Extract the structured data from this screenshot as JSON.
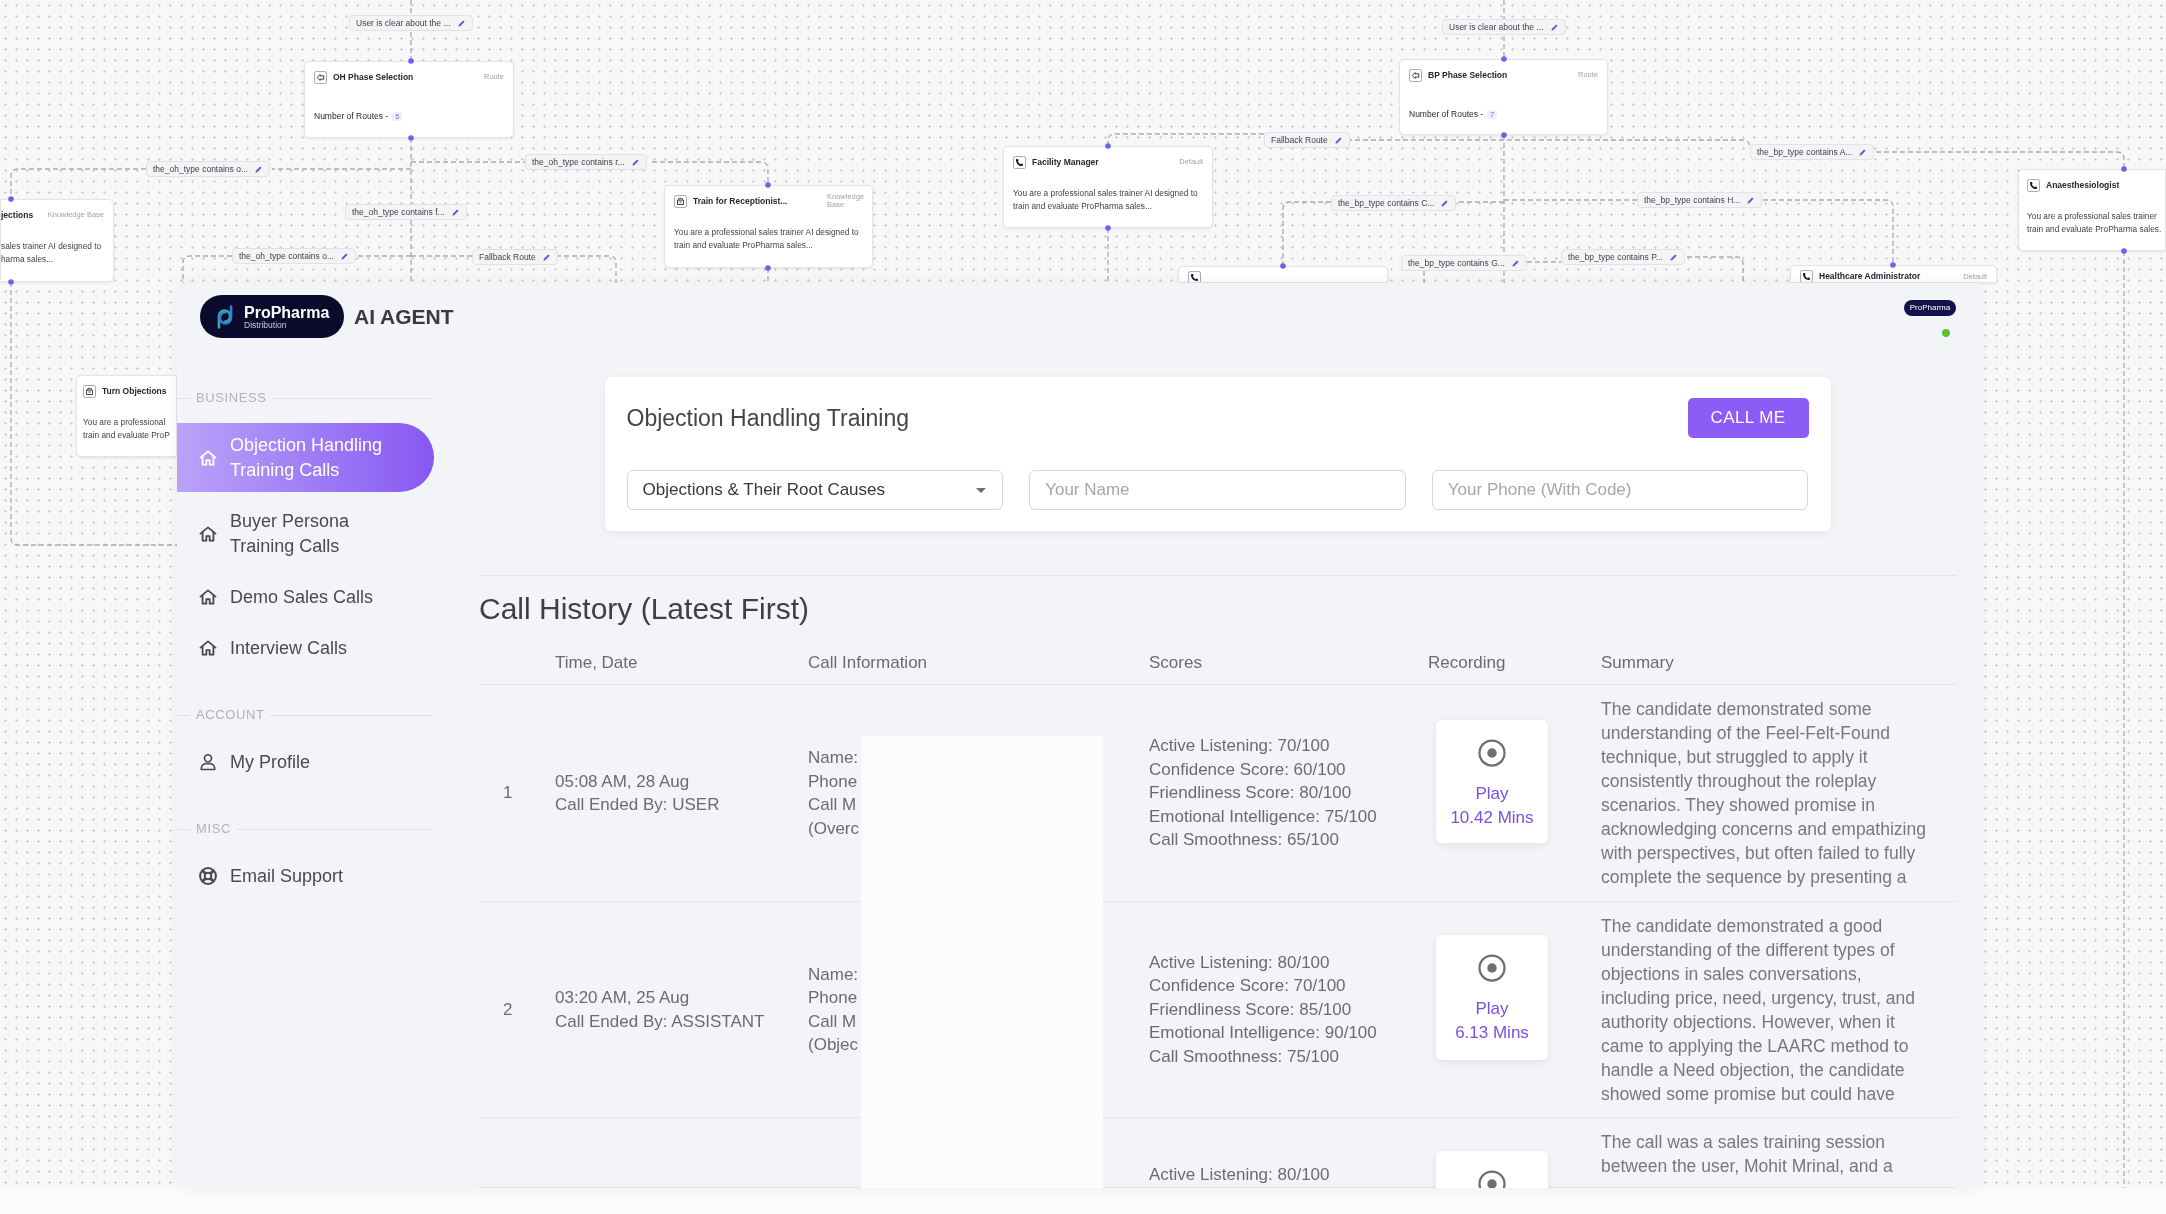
{
  "diagram": {
    "edge_labels": [
      {
        "text": "User is clear about the ..."
      },
      {
        "text": "User is clear about the ..."
      },
      {
        "text": "Fallback Route"
      },
      {
        "text": "the_bp_type contains A..."
      },
      {
        "text": "the_oh_type contains o..."
      },
      {
        "text": "the_oh_type contains r..."
      },
      {
        "text": "the_bp_type contains C..."
      },
      {
        "text": "the_bp_type contains H..."
      },
      {
        "text": "the_oh_type contains f..."
      },
      {
        "text": "the_oh_type contains o..."
      },
      {
        "text": "Fallback Route"
      },
      {
        "text": "the_bp_type contains G..."
      },
      {
        "text": "the_bp_type contains P..."
      }
    ],
    "nodes": [
      {
        "kind": "route",
        "title": "OH Phase Selection",
        "tag": "Route",
        "routes_label": "Number of Routes -",
        "routes_count": "5"
      },
      {
        "kind": "route",
        "title": "BP Phase Selection",
        "tag": "Route",
        "routes_label": "Number of Routes -",
        "routes_count": "7"
      },
      {
        "kind": "conversation",
        "title": "Facility Manager",
        "tag": "Default",
        "lines": [
          "You are a professional sales trainer AI designed to",
          "train and evaluate ProPharma sales..."
        ]
      },
      {
        "kind": "knowledge",
        "title": "jections",
        "tag": "Knowledge Base",
        "lines": [
          "sales trainer AI designed to",
          "harma sales..."
        ]
      },
      {
        "kind": "knowledge",
        "title": "Train for Receptionist...",
        "tag": "Knowledge Base",
        "lines": [
          "You are a professional sales trainer AI designed to",
          "train and evaluate ProPharma sales..."
        ]
      },
      {
        "kind": "conversation",
        "title": "Anaesthesiologist",
        "lines": [
          "You are a professional sales trainer",
          "train and evaluate ProPharma sales."
        ]
      },
      {
        "kind": "conversation"
      },
      {
        "kind": "conversation",
        "title": "Healthcare Administrator",
        "tag": "Default"
      },
      {
        "kind": "knowledge",
        "title": "Turn Objections",
        "lines": [
          "You are a professional",
          "train and evaluate ProP"
        ]
      }
    ]
  },
  "app": {
    "logo": {
      "name": "ProPharma",
      "tagline": "Distribution"
    },
    "title": "AI AGENT",
    "avatar": {
      "text": "ProPharma",
      "online": true
    },
    "sidebar": [
      {
        "heading": "BUSINESS",
        "items": [
          {
            "label": "Objection Handling Training Calls",
            "selected": true
          },
          {
            "label": "Buyer Persona Training Calls",
            "selected": false
          },
          {
            "label": "Demo Sales Calls",
            "selected": false
          },
          {
            "label": "Interview Calls",
            "selected": false
          }
        ]
      },
      {
        "heading": "ACCOUNT",
        "items": [
          {
            "label": "My Profile",
            "selected": false
          }
        ]
      },
      {
        "heading": "MISC",
        "items": [
          {
            "label": "Email Support",
            "selected": false
          }
        ]
      }
    ],
    "form": {
      "title": "Objection Handling Training",
      "button": "CALL ME",
      "select": {
        "value": "Objections & Their Root Causes"
      },
      "fields": [
        {
          "placeholder": "Your Name"
        },
        {
          "placeholder": "Your Phone (With Code)"
        }
      ]
    },
    "history": {
      "title": "Call History (Latest First)",
      "columns": [
        "Time, Date",
        "Call Information",
        "Scores",
        "Recording",
        "Summary"
      ],
      "rows": [
        {
          "index": "1",
          "time": "05:08 AM, 28 Aug",
          "ended_by": "Call Ended By: USER",
          "call_info": [
            "Name:",
            "Phone",
            "Call M",
            "(Overc"
          ],
          "scores": [
            "Active Listening: 70/100",
            "Confidence Score: 60/100",
            "Friendliness Score: 80/100",
            "Emotional Intelligence: 75/100",
            "Call Smoothness: 65/100"
          ],
          "recording": {
            "kind": "card",
            "label": "Play",
            "duration": "10.42 Mins"
          },
          "summary": "The candidate demonstrated some understanding of the Feel-Felt-Found technique, but struggled to apply it consistently throughout the roleplay scenarios. They showed promise in acknowledging concerns and empathizing with perspectives, but often failed to fully complete the sequence by presenting a"
        },
        {
          "index": "2",
          "time": "03:20 AM, 25 Aug",
          "ended_by": "Call Ended By: ASSISTANT",
          "call_info": [
            "Name:",
            "Phone",
            "Call M",
            "(Objec"
          ],
          "scores": [
            "Active Listening: 80/100",
            "Confidence Score: 70/100",
            "Friendliness Score: 85/100",
            "Emotional Intelligence: 90/100",
            "Call Smoothness: 75/100"
          ],
          "recording": {
            "kind": "card",
            "label": "Play",
            "duration": "6.13 Mins"
          },
          "summary": "The candidate demonstrated a good understanding of the different types of objections in sales conversations, including price, need, urgency, trust, and authority objections. However, when it came to applying the LAARC method to handle a Need objection, the candidate showed some promise but could have"
        },
        {
          "scores": [
            "Active Listening: 80/100"
          ],
          "recording": {
            "kind": "card"
          },
          "summary": "The call was a sales training session between the user, Mohit Mrinal, and a"
        }
      ]
    }
  }
}
